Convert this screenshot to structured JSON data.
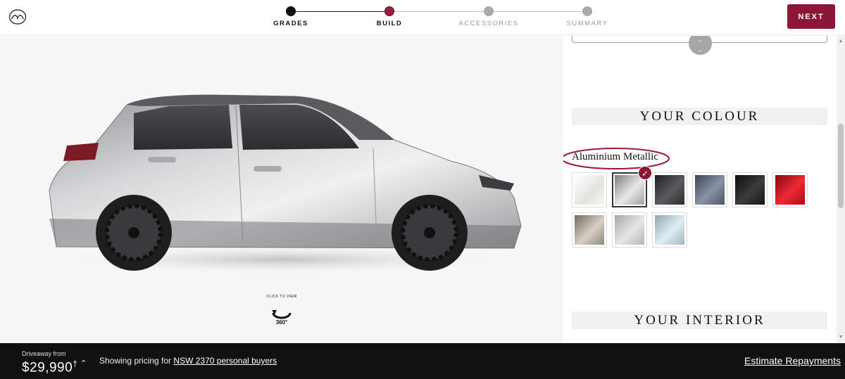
{
  "header": {
    "logo_icon": "mazda-logo-icon",
    "steps": [
      {
        "label": "GRADES",
        "state": "done"
      },
      {
        "label": "BUILD",
        "state": "active"
      },
      {
        "label": "ACCESSORIES",
        "state": "inactive"
      },
      {
        "label": "SUMMARY",
        "state": "inactive"
      }
    ],
    "next_label": "NEXT",
    "accent_color": "#8b1734"
  },
  "stage": {
    "view_360_top": "CLICK TO VIEW",
    "view_360_bottom": "360°"
  },
  "panel": {
    "colour_heading": "YOUR COLOUR",
    "selected_colour": "Aluminium Metallic",
    "swatches": [
      {
        "color": "#eeeeea"
      },
      {
        "color": "#b7b8ba",
        "selected": true
      },
      {
        "color": "#3a3b3d"
      },
      {
        "color": "#5d6677"
      },
      {
        "color": "#1b1b1c"
      },
      {
        "color": "#c8111e"
      },
      {
        "color": "#aba597"
      },
      {
        "color": "#c9c9c9"
      },
      {
        "color": "#aec4cc"
      }
    ],
    "interior_heading": "YOUR INTERIOR"
  },
  "footer": {
    "price_label": "Driveaway from",
    "price": "$29,990",
    "price_mark": "†",
    "showing_text": "Showing pricing for",
    "showing_link": "NSW 2370 personal buyers",
    "estimate_link": "Estimate Repayments"
  }
}
